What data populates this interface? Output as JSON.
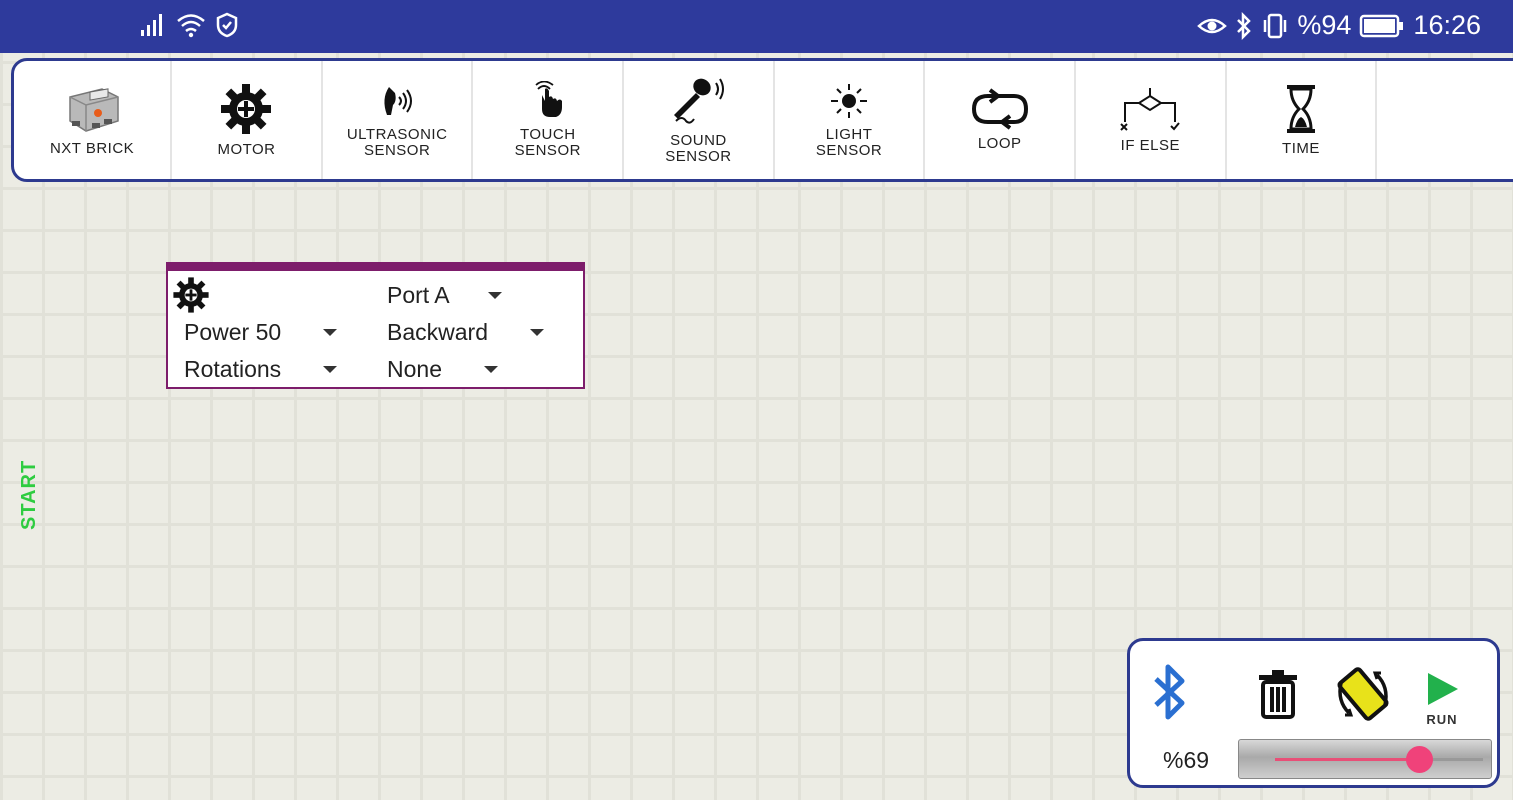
{
  "status_bar": {
    "battery": "%94",
    "time": "16:26"
  },
  "palette": {
    "items": [
      {
        "id": "nxt-brick",
        "label": "NXT BRICK",
        "icon": "nxt-brick-icon"
      },
      {
        "id": "motor",
        "label": "MOTOR",
        "icon": "gear-icon"
      },
      {
        "id": "ultrasonic-sensor",
        "label": "ULTRASONIC\nSENSOR",
        "icon": "ultrasonic-icon"
      },
      {
        "id": "touch-sensor",
        "label": "TOUCH\nSENSOR",
        "icon": "touch-hand-icon"
      },
      {
        "id": "sound-sensor",
        "label": "SOUND\nSENSOR",
        "icon": "microphone-icon"
      },
      {
        "id": "light-sensor",
        "label": "LIGHT\nSENSOR",
        "icon": "light-icon"
      },
      {
        "id": "loop",
        "label": "LOOP",
        "icon": "loop-icon"
      },
      {
        "id": "if-else",
        "label": "IF ELSE",
        "icon": "if-else-icon"
      },
      {
        "id": "time",
        "label": "TIME",
        "icon": "hourglass-icon"
      }
    ]
  },
  "motor_block": {
    "port": "Port A",
    "power": "Power 50",
    "direction": "Backward",
    "mode": "Rotations",
    "stop": "None"
  },
  "start_label": "START",
  "control_panel": {
    "run_label": "RUN",
    "speed_label": "%69",
    "speed_value": 69
  },
  "colors": {
    "status_bar": "#2e3a9c",
    "panel_border": "#2d3a8f",
    "motor_block_accent": "#7d1d6b",
    "start_text": "#2ecc40",
    "run_icon": "#22b14c",
    "slider_thumb": "#f0427a"
  }
}
